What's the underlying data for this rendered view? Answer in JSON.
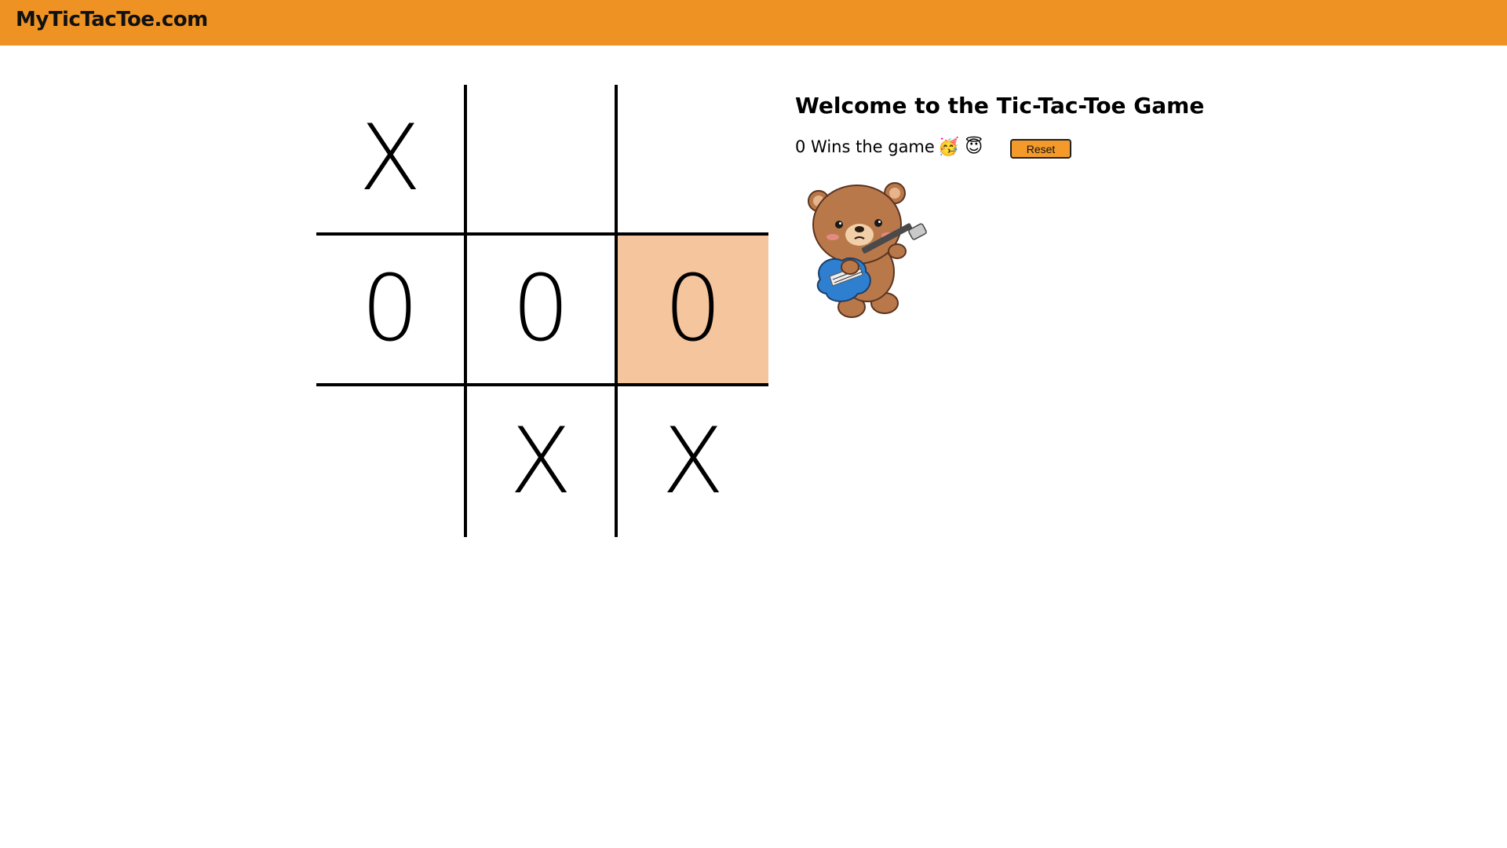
{
  "header": {
    "brand": "MyTicTacToe.com"
  },
  "board": {
    "cells": [
      "X",
      "",
      "",
      "0",
      "0",
      "0",
      "",
      "X",
      "X"
    ],
    "highlighted_cell": 5,
    "highlight_color": "#f5c59d"
  },
  "panel": {
    "title": "Welcome to the Tic-Tac-Toe Game",
    "status": "0 Wins the game",
    "emojis": "🥳 😇",
    "reset_label": "Reset"
  },
  "colors": {
    "accent": "#ee9323",
    "button": "#f39a2a"
  },
  "illustration": "teddy-bear-playing-guitar"
}
